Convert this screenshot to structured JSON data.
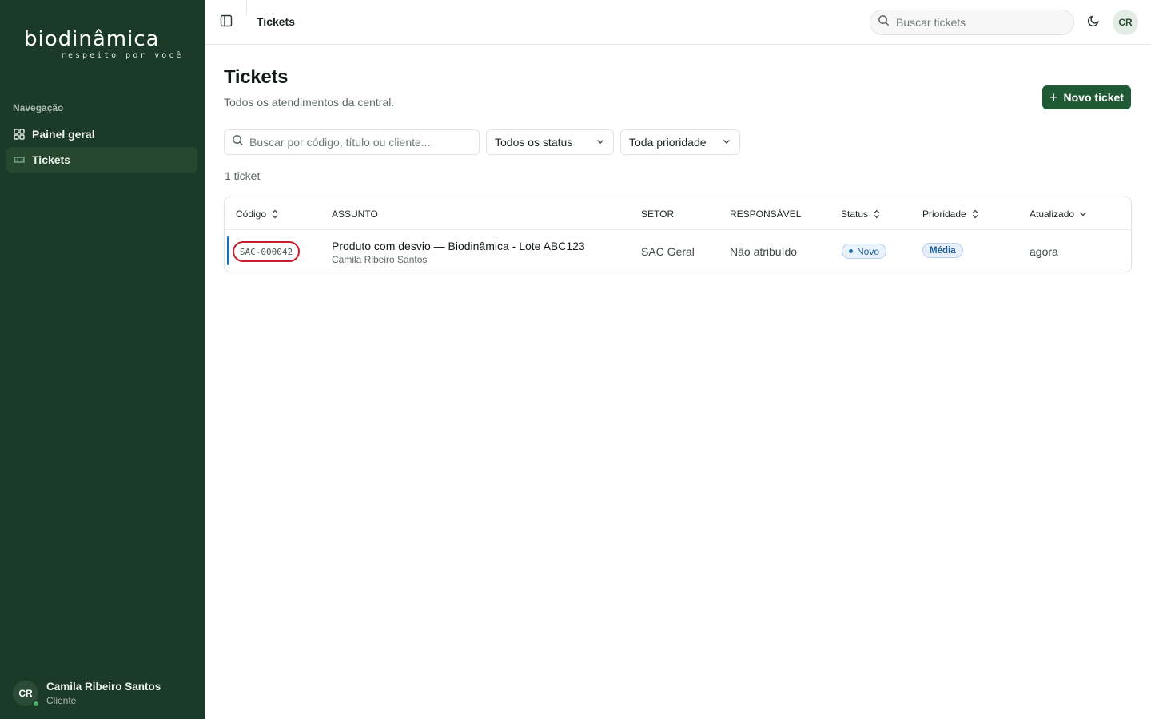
{
  "brand": {
    "name": "biodinâmica",
    "tagline": "respeito por você"
  },
  "sidebar": {
    "heading": "Navegação",
    "items": [
      {
        "label": "Painel geral",
        "icon": "dashboard-grid-icon"
      },
      {
        "label": "Tickets",
        "icon": "ticket-icon",
        "active": true
      }
    ],
    "user": {
      "initials": "CR",
      "name": "Camila Ribeiro Santos",
      "role": "Cliente",
      "online": true
    }
  },
  "topbar": {
    "title": "Tickets",
    "search_placeholder": "Buscar tickets",
    "avatar_initials": "CR"
  },
  "page": {
    "title": "Tickets",
    "subtitle": "Todos os atendimentos da central.",
    "new_button": "Novo ticket",
    "filter_search_placeholder": "Buscar por código, título ou cliente...",
    "status_filter": "Todos os status",
    "priority_filter": "Toda prioridade",
    "count_label": "1 ticket"
  },
  "table": {
    "headers": {
      "code": "Código",
      "subject": "ASSUNTO",
      "sector": "SETOR",
      "assignee": "RESPONSÁVEL",
      "status": "Status",
      "priority": "Prioridade",
      "updated": "Atualizado"
    },
    "rows": [
      {
        "code": "SAC-000042",
        "title": "Produto com desvio — Biodinâmica - Lote ABC123",
        "client": "Camila Ribeiro Santos",
        "sector": "SAC Geral",
        "assignee": "Não atribuído",
        "status": "Novo",
        "priority": "Média",
        "updated": "agora"
      }
    ]
  },
  "colors": {
    "sidebar_bg": "#1b3a27",
    "primary": "#1f5a35",
    "status_blue": "#1e6fae",
    "highlight_red": "#c8202f"
  }
}
